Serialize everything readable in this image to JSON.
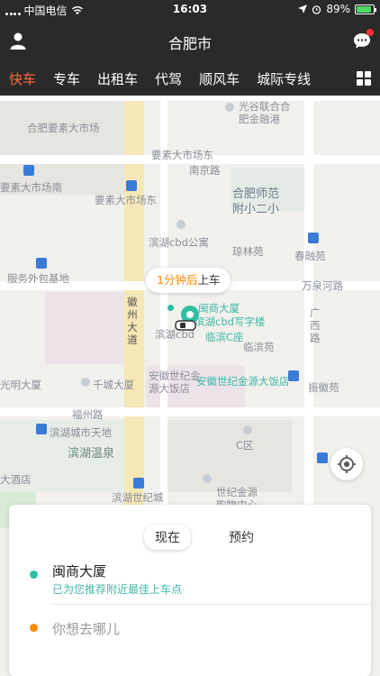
{
  "status_bar": {
    "carrier": "中国电信",
    "time": "16:03",
    "battery": "89%",
    "battery_level": 0.89
  },
  "nav": {
    "title": "合肥市",
    "has_notification": true
  },
  "tabs": [
    {
      "label": "快车",
      "active": true
    },
    {
      "label": "专车",
      "active": false
    },
    {
      "label": "出租车",
      "active": false
    },
    {
      "label": "代驾",
      "active": false
    },
    {
      "label": "顺风车",
      "active": false
    },
    {
      "label": "城际专线",
      "active": false
    }
  ],
  "map": {
    "labels": {
      "a": "光谷联合合",
      "b": "肥金融港",
      "c": "合肥要素大市场",
      "d": "要素大市场东",
      "e": "南京路",
      "f": "要素大市场南",
      "g": "要素大市场东",
      "h": "合肥师范",
      "i": "附小二小",
      "j": "滨湖cbd公寓",
      "k": "琼林苑",
      "l": "春融苑",
      "m": "服务外包基地",
      "n": "万泉河路",
      "o": "徽州大道",
      "p": "闽商大厦",
      "q": "滨湖cbd写字楼",
      "r": "滨湖cbd",
      "s": "临滨C座",
      "t": "广西路",
      "u": "临滨苑",
      "v": "光明大厦",
      "w": "千城大厦",
      "x": "安徽世纪金源大饭店",
      "y": "安徽世纪金源大饭店",
      "z": "振徽苑",
      "aa": "福州路",
      "ab": "滨湖城市天地",
      "ac": "滨湖温泉",
      "ad": "C区",
      "ae": "大酒店",
      "af": "滨湖世纪城",
      "ag": "世纪金源",
      "ah": "购物中心"
    },
    "pickup_tip": {
      "eta": "1分钟后",
      "action": "上车"
    }
  },
  "panel": {
    "modes": [
      {
        "label": "现在",
        "active": true
      },
      {
        "label": "预约",
        "active": false
      }
    ],
    "from": {
      "name": "闽商大厦",
      "hint": "已为您推荐附近最佳上车点"
    },
    "to": {
      "placeholder": "你想去哪儿"
    }
  },
  "colors": {
    "accent": "#ff6a3d",
    "teal": "#2fbfa0",
    "orange": "#ff8a00",
    "bar": "#2a2a2a"
  }
}
